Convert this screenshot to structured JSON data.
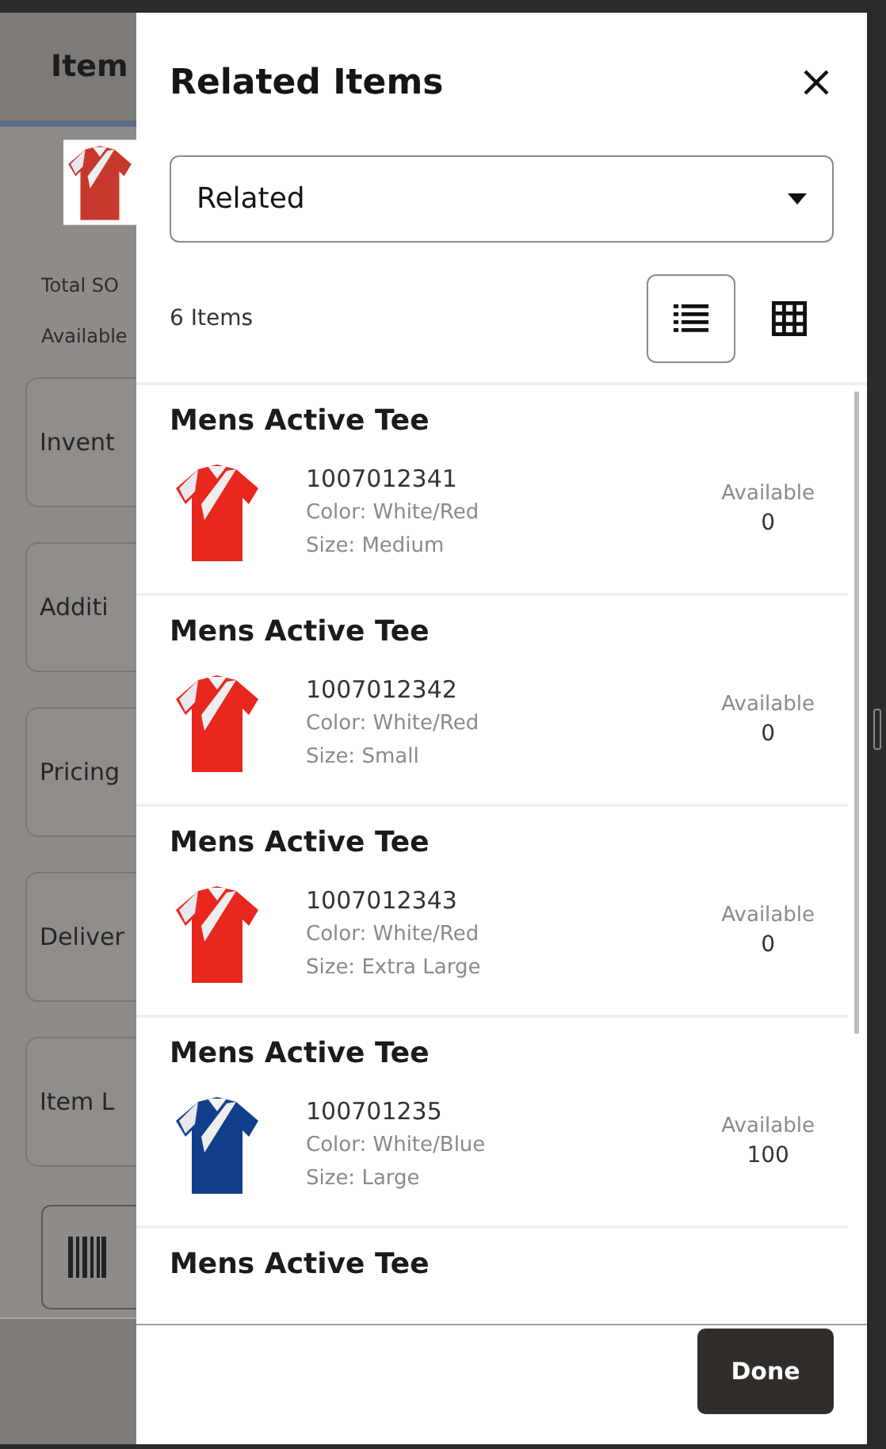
{
  "background_page": {
    "title": "Item",
    "stats": [
      "Total SO",
      "Available"
    ],
    "cards": [
      "Invent",
      "Additi",
      "Pricing",
      "Deliver",
      "Item L"
    ]
  },
  "dialog": {
    "title": "Related Items",
    "filter": {
      "value": "Related"
    },
    "count": "6 Items",
    "views": [
      {
        "kind": "list",
        "selected": true
      },
      {
        "kind": "grid",
        "selected": false
      }
    ],
    "items": [
      {
        "name": "Mens Active Tee",
        "number": "1007012341",
        "color_text": "Color: White/Red",
        "size": "Size: Medium",
        "available_label": "Available",
        "available": "0"
      },
      {
        "name": "Mens Active Tee",
        "number": "1007012342",
        "color_text": "Color: White/Red",
        "size": "Size: Small",
        "available_label": "Available",
        "available": "0"
      },
      {
        "name": "Mens Active Tee",
        "number": "1007012343",
        "color_text": "Color: White/Red",
        "size": "Size: Extra Large",
        "available_label": "Available",
        "available": "0"
      },
      {
        "name": "Mens Active Tee",
        "number": "100701235",
        "color_text": "Color: White/Blue",
        "size": "Size: Large",
        "available_label": "Available",
        "available": "100"
      },
      {
        "name": "Mens Active Tee"
      }
    ],
    "done": "Done"
  }
}
